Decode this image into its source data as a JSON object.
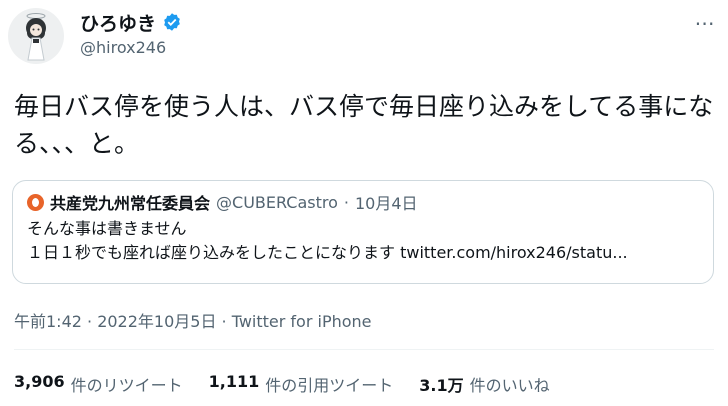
{
  "author": {
    "display_name": "ひろゆき",
    "handle": "@hirox246",
    "verified_icon": "verified-badge-icon"
  },
  "tweet": {
    "text": "毎日バス停を使う人は、バス停で毎日座り込みをしてる事になる、、、と。"
  },
  "quote": {
    "name": "共産党九州常任委員会",
    "handle": "@CUBERCastro",
    "separator": "·",
    "date": "10月4日",
    "line1": "そんな事は書きません",
    "line2": "１日１秒でも座れば座り込みをしたことになります twitter.com/hirox246/statu..."
  },
  "meta": {
    "text": "午前1:42 · 2022年10月5日 · Twitter for iPhone"
  },
  "stats": [
    {
      "value": "3,906",
      "label": "件のリツイート"
    },
    {
      "value": "1,111",
      "label": "件の引用ツイート"
    },
    {
      "value": "3.1万",
      "label": "件のいいね"
    }
  ],
  "colors": {
    "text": "#0f1419",
    "secondary": "#536471",
    "border": "#cfd9de",
    "verified": "#1d9bf0",
    "quote_logo": "#e8642a"
  }
}
